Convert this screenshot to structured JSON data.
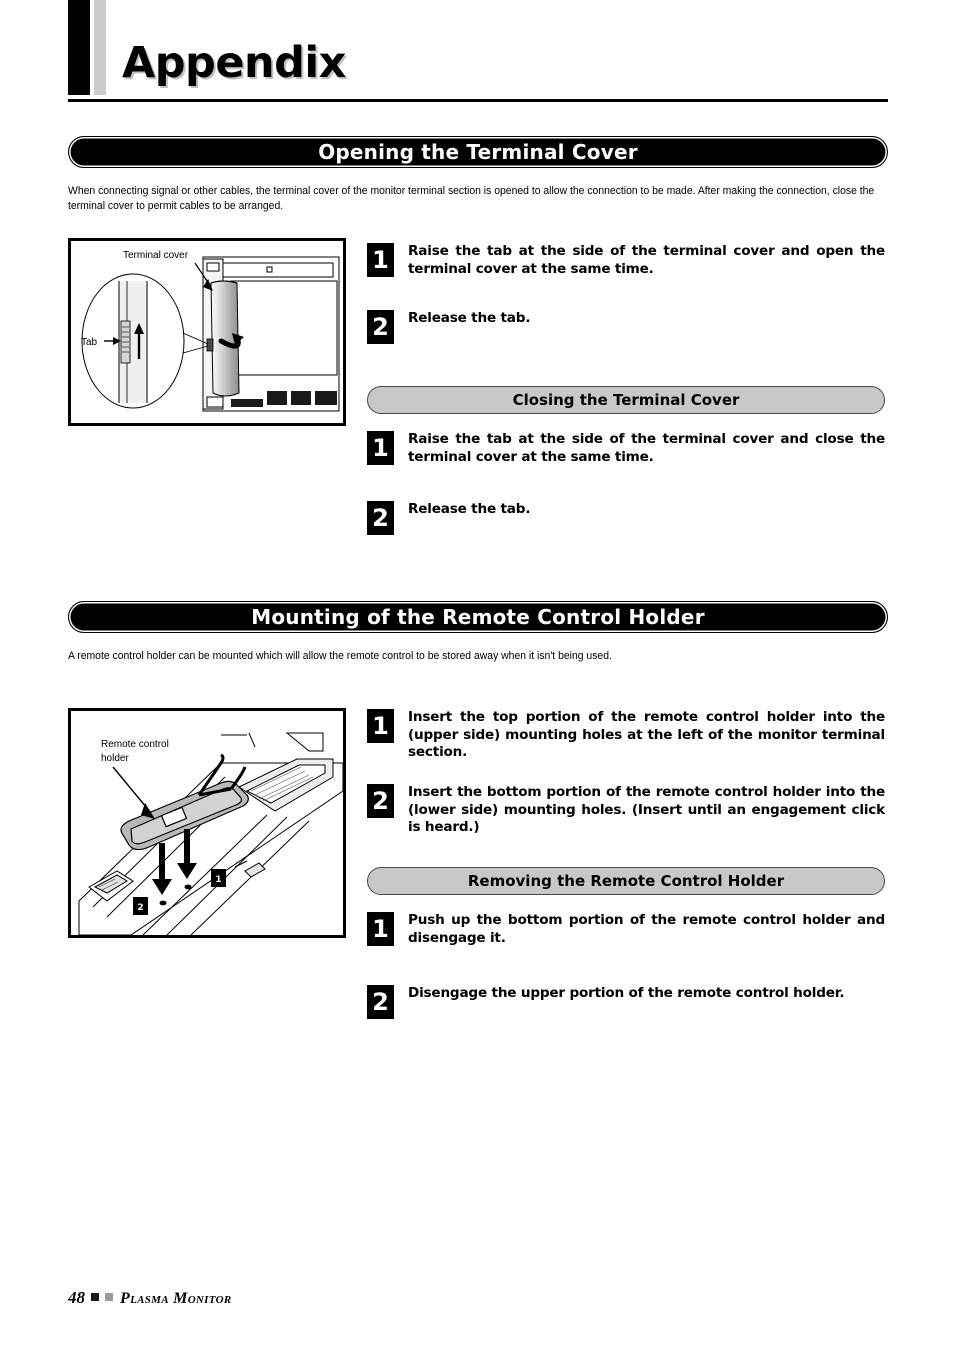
{
  "page": {
    "title": "Appendix",
    "footer": {
      "page_number": "48",
      "brand": "Plasma Monitor",
      "marker_dark": "square-marker-dark",
      "marker_gray": "square-marker-gray"
    }
  },
  "sections": [
    {
      "banner": "Opening the Terminal Cover",
      "intro": "When connecting signal or other cables, the terminal cover of the monitor terminal section is opened to allow the connection to be made. After making the connection, close the terminal cover to permit cables to be arranged.",
      "figure": {
        "name": "terminal-cover-illustration",
        "labels": {
          "terminal_cover": "Terminal cover",
          "tab": "Tab"
        }
      },
      "steps": [
        {
          "num": "1",
          "text": "Raise the tab at the side of the terminal cover and open the terminal cover at the same time."
        },
        {
          "num": "2",
          "text": "Release the tab."
        }
      ],
      "subsection": {
        "banner": "Closing the Terminal Cover",
        "steps": [
          {
            "num": "1",
            "text": "Raise the tab at the side of the terminal cover and close the terminal cover at the same time."
          },
          {
            "num": "2",
            "text": "Release the tab."
          }
        ]
      }
    },
    {
      "banner": "Mounting of the Remote Control Holder",
      "intro": "A remote control holder can be mounted which will allow the remote control to be stored away when it isn't being used.",
      "figure": {
        "name": "remote-control-holder-illustration",
        "labels": {
          "holder_line1": "Remote control",
          "holder_line2": "holder",
          "callout_1": "1",
          "callout_2": "2"
        }
      },
      "steps": [
        {
          "num": "1",
          "text": "Insert the top portion of the remote control holder into the (upper side) mounting holes at the left of the monitor terminal section."
        },
        {
          "num": "2",
          "text": "Insert the bottom portion of the remote control holder into the (lower side) mounting holes. (Insert until an engagement click is heard.)"
        }
      ],
      "subsection": {
        "banner": "Removing the Remote Control Holder",
        "steps": [
          {
            "num": "1",
            "text": "Push up the bottom portion of the remote control holder and disengage it."
          },
          {
            "num": "2",
            "text": "Disengage the upper portion of the remote control holder."
          }
        ]
      }
    }
  ]
}
